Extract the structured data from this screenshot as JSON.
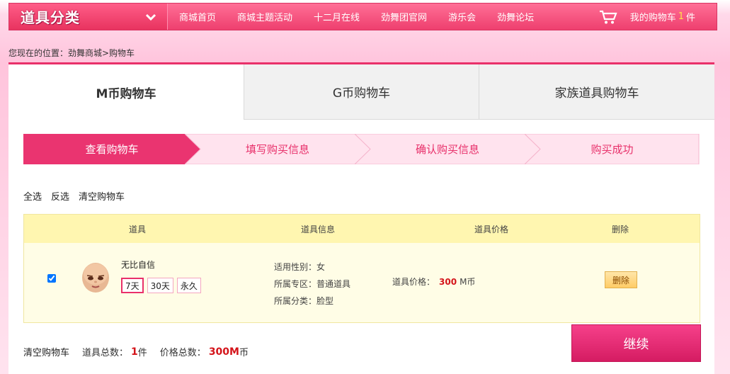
{
  "nav": {
    "category_title": "道具分类",
    "links": [
      "商城首页",
      "商城主题活动",
      "十二月在线",
      "劲舞团官网",
      "游乐会",
      "劲舞论坛"
    ],
    "cart_prefix": "我的购物车",
    "cart_count": "1",
    "cart_suffix": "件"
  },
  "breadcrumb": "您现在的位置：劲舞商城>购物车",
  "tabs": [
    "M币购物车",
    "G币购物车",
    "家族道具购物车"
  ],
  "steps": [
    "查看购物车",
    "填写购买信息",
    "确认购买信息",
    "购买成功"
  ],
  "actions": [
    "全选",
    "反选",
    "清空购物车"
  ],
  "table": {
    "headers": [
      "道具",
      "道具信息",
      "道具价格",
      "删除"
    ],
    "row": {
      "name": "无比自信",
      "durations": [
        "7天",
        "30天",
        "永久"
      ],
      "gender": "适用性别：女",
      "zone": "所属专区：普通道具",
      "category": "所属分类：脸型",
      "price_label": "道具价格：",
      "price_value": "300",
      "price_unit": "M币",
      "delete_label": "删除",
      "checked": true
    }
  },
  "footer": {
    "clear_label": "清空购物车",
    "total_label": "道具总数：",
    "total_count": "1",
    "total_unit": "件",
    "price_label": "价格总数：",
    "price_value": "300M",
    "price_unit": "币"
  },
  "continue_label": "继续",
  "colors": {
    "accent": "#e9306a",
    "price": "#d4141a",
    "table_header": "#fff6b0"
  }
}
